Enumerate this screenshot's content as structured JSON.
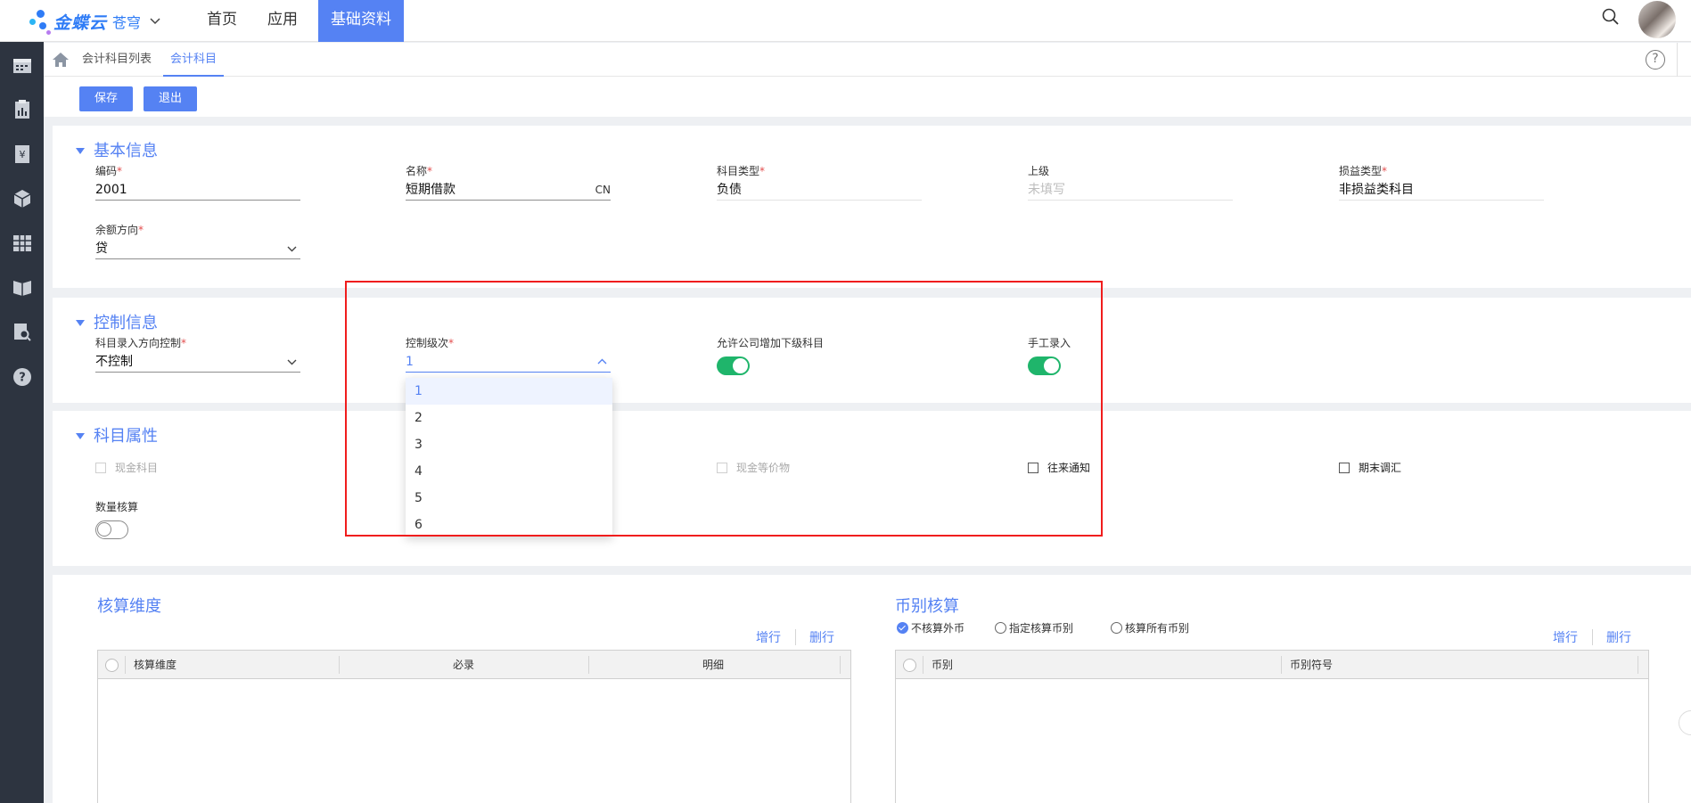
{
  "app": {
    "logo_text": "金蝶云",
    "logo_sub": "苍穹",
    "nav": [
      {
        "label": "首页"
      },
      {
        "label": "应用"
      },
      {
        "label": "基础资料"
      }
    ]
  },
  "breadcrumb_tabs": [
    {
      "label": "会计科目列表"
    },
    {
      "label": "会计科目"
    }
  ],
  "toolbar": {
    "save_label": "保存",
    "exit_label": "退出"
  },
  "basic": {
    "title": "基本信息",
    "code": {
      "label": "编码",
      "value": "2001"
    },
    "name": {
      "label": "名称",
      "value": "短期借款",
      "suffix": "CN"
    },
    "type": {
      "label": "科目类型",
      "value": "负债"
    },
    "parent": {
      "label": "上级",
      "placeholder": "未填写"
    },
    "pl_type": {
      "label": "损益类型",
      "value": "非损益类科目"
    },
    "balance_dir": {
      "label": "余额方向",
      "value": "贷"
    }
  },
  "control": {
    "title": "控制信息",
    "entry_dir": {
      "label": "科目录入方向控制",
      "value": "不控制"
    },
    "level": {
      "label": "控制级次",
      "value": "1"
    },
    "allow_add_sub": {
      "label": "允许公司增加下级科目",
      "on": true
    },
    "manual_entry": {
      "label": "手工录入",
      "on": true
    },
    "level_options": [
      "1",
      "2",
      "3",
      "4",
      "5",
      "6"
    ]
  },
  "attrs": {
    "title": "科目属性",
    "cash": "现金科目",
    "cash_equiv": "现金等价物",
    "notice": "往来通知",
    "period_end": "期末调汇",
    "qty": {
      "label": "数量核算",
      "on": false
    }
  },
  "dimension": {
    "title": "核算维度",
    "add_row": "增行",
    "del_row": "删行",
    "columns": [
      "核算维度",
      "必录",
      "明细"
    ]
  },
  "currency": {
    "title": "币别核算",
    "options": [
      "不核算外币",
      "指定核算币别",
      "核算所有币别"
    ],
    "selected": "不核算外币",
    "add_row": "增行",
    "del_row": "删行",
    "columns": [
      "币别",
      "币别符号"
    ]
  },
  "colors": {
    "accent": "#5582f3",
    "sidebar": "#2d3440",
    "toggle_on": "#1fb56b",
    "highlight_box": "#f01d1d"
  }
}
